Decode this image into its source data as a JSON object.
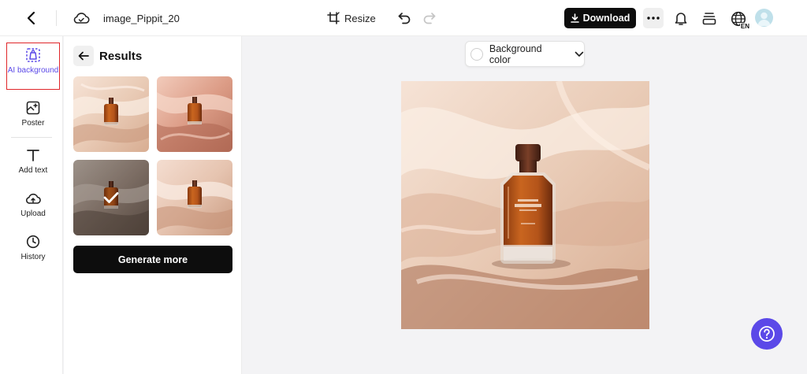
{
  "header": {
    "file_name": "image_Pippit_20",
    "resize_label": "Resize",
    "download_label": "Download",
    "language_code": "EN"
  },
  "rail": {
    "items": [
      {
        "label": "AI background",
        "active": true
      },
      {
        "label": "Poster"
      },
      {
        "label": "Add text"
      },
      {
        "label": "Upload"
      },
      {
        "label": "History"
      }
    ]
  },
  "panel": {
    "title": "Results",
    "selected_index": 2,
    "generate_label": "Generate more"
  },
  "canvas": {
    "background_color_label": "Background color"
  },
  "colors": {
    "accent": "#5b49e8",
    "highlight_border": "#e0262a",
    "primary_button": "#0d0d0d"
  }
}
